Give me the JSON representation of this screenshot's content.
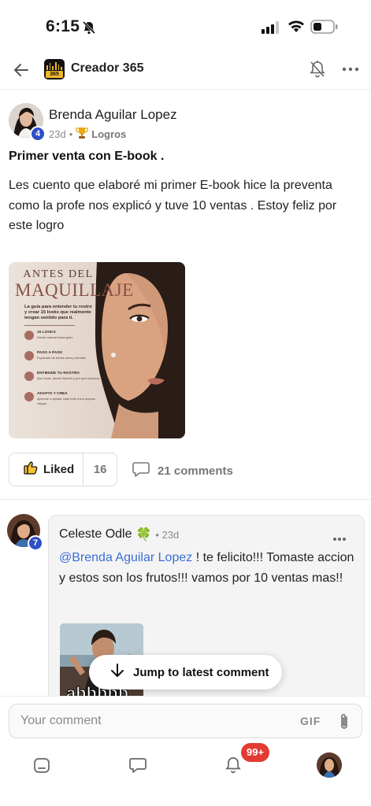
{
  "status_bar": {
    "time": "6:15"
  },
  "header": {
    "title": "Creador 365",
    "logo_text": "365"
  },
  "post": {
    "author": "Brenda Aguilar Lopez",
    "level": "4",
    "age": "23d",
    "separator": "•",
    "category": "Logros",
    "title": "Primer venta con E-book .",
    "body": "Les cuento que elaboré mi primer E-book hice la preventa como la profe nos explicó y tuve 10 ventas . Estoy feliz por este logro",
    "image": {
      "heading_1": "ANTES DEL",
      "heading_2": "MAQUILLAJE",
      "intro": "La guía para entender tu rostro y crear 15 looks que realmente tengan sentido para ti.",
      "items": [
        {
          "title": "15 LOOKS",
          "sub": "Desde natural hasta glam"
        },
        {
          "title": "PASO A PASO",
          "sub": "Explicado de forma clara y sencilla"
        },
        {
          "title": "ENTIENDE TU ROSTRO",
          "sub": "Qué tocar, dónde hacerlo y por qué funciona"
        },
        {
          "title": "ADAPTA Y CREA",
          "sub": "Aprende a ajustar cada look a tus propios rasgos"
        }
      ]
    },
    "liked_label": "Liked",
    "like_count": "16",
    "comments_label": "21 comments"
  },
  "comment": {
    "author": "Celeste Odle",
    "level": "7",
    "emoji": "🍀",
    "time": "• 23d",
    "mention": "@Brenda Aguilar Lopez",
    "text_after_mention": " ! te felicito!!! Tomaste accion y estos son los frutos!!! vamos por 10 ventas mas!!",
    "gif_caption": "ahhhhh"
  },
  "jump_button": {
    "label": "Jump to latest comment"
  },
  "composer": {
    "placeholder": "Your comment",
    "gif_label": "GIF"
  },
  "tabbar": {
    "notification_count": "99+"
  }
}
